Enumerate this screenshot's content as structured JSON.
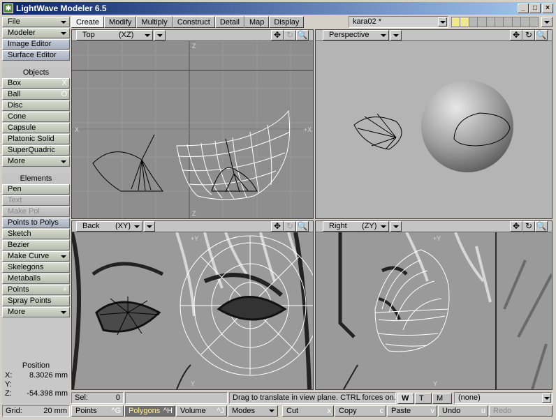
{
  "window": {
    "title": "LightWave Modeler 6.5",
    "buttons": [
      "_",
      "□",
      "×"
    ]
  },
  "sidebar": {
    "file": "File",
    "modeler": "Modeler",
    "image_editor": "Image Editor",
    "surface_editor": "Surface Editor",
    "objects_header": "Objects",
    "objects": [
      {
        "label": "Box",
        "key": "X"
      },
      {
        "label": "Ball",
        "key": "O"
      },
      {
        "label": "Disc",
        "key": ""
      },
      {
        "label": "Cone",
        "key": ""
      },
      {
        "label": "Capsule",
        "key": ""
      },
      {
        "label": "Platonic Solid",
        "key": ""
      },
      {
        "label": "SuperQuadric",
        "key": ""
      },
      {
        "label": "More",
        "key": ""
      }
    ],
    "elements_header": "Elements",
    "elements": [
      {
        "label": "Pen",
        "key": ""
      },
      {
        "label": "Text",
        "key": ""
      },
      {
        "label": "Make Pol",
        "key": ""
      },
      {
        "label": "Points to Polys",
        "key": ""
      },
      {
        "label": "Sketch",
        "key": ""
      },
      {
        "label": "Bezier",
        "key": ""
      },
      {
        "label": "Make Curve",
        "key": ""
      },
      {
        "label": "Skelegons",
        "key": ""
      },
      {
        "label": "Metaballs",
        "key": ""
      },
      {
        "label": "Points",
        "key": "+"
      },
      {
        "label": "Spray Points",
        "key": ""
      },
      {
        "label": "More",
        "key": ""
      }
    ],
    "position": {
      "title": "Position",
      "x_label": "X:",
      "x_value": "8.3026 mm",
      "y_label": "Y:",
      "y_value": "",
      "z_label": "Z:",
      "z_value": "-54.398 mm"
    },
    "grid": {
      "label": "Grid:",
      "value": "20 mm"
    }
  },
  "tabs": [
    "Create",
    "Modify",
    "Multiply",
    "Construct",
    "Detail",
    "Map",
    "Display"
  ],
  "active_tab": "Create",
  "object_select": "kara02 *",
  "viewports": {
    "top": {
      "label": "Top",
      "axes": "(XZ)",
      "ax_top": "Z",
      "ax_left": "X",
      "ax_right": "+X",
      "ax_bottom": "Z"
    },
    "perspective": {
      "label": "Perspective"
    },
    "back": {
      "label": "Back",
      "axes": "(XY)",
      "ax_top": "+Y",
      "ax_bottom": "Y"
    },
    "right": {
      "label": "Right",
      "axes": "(ZY)",
      "ax_top": "+Y",
      "ax_bottom": "Y"
    }
  },
  "status": {
    "sel_label": "Sel:",
    "sel_value": "0",
    "message": "Drag to translate in view plane. CTRL forces on...",
    "w": "W",
    "t": "T",
    "m": "M",
    "layer": "(none)"
  },
  "bottom": {
    "points": "Points",
    "points_key": "^G",
    "polygons": "Polygons",
    "polygons_key": "^H",
    "volume": "Volume",
    "volume_key": "^J",
    "modes": "Modes",
    "cut": "Cut",
    "cut_key": "x",
    "copy": "Copy",
    "copy_key": "c",
    "paste": "Paste",
    "paste_key": "v",
    "undo": "Undo",
    "undo_key": "u",
    "redo": "Redo"
  }
}
